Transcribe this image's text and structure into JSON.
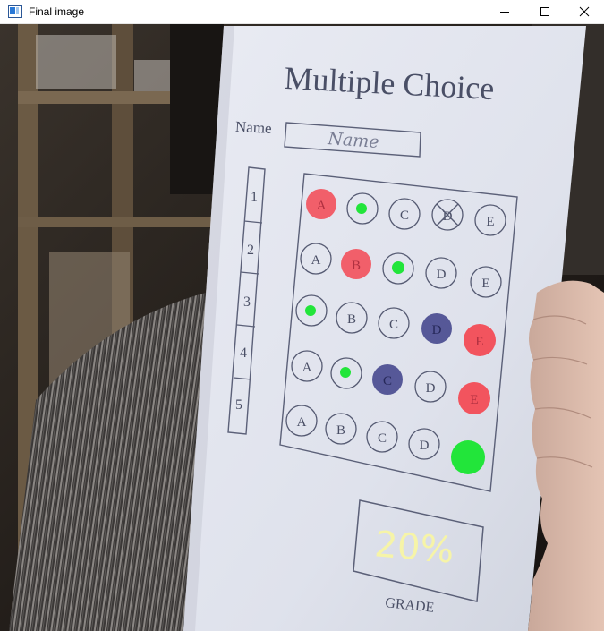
{
  "window": {
    "title": "Final image",
    "icon": "app-window-icon",
    "controls": [
      "minimize-icon",
      "maximize-icon",
      "close-icon"
    ]
  },
  "sheet": {
    "heading": "Multiple Choice",
    "name_label": "Name",
    "name_value": "Name",
    "question_numbers": [
      "1",
      "2",
      "3",
      "4",
      "5"
    ],
    "choices": [
      "A",
      "B",
      "C",
      "D",
      "E"
    ],
    "grade_value": "20%",
    "grade_label": "GRADE"
  },
  "answers": {
    "rows": [
      {
        "marked": "A",
        "correct": "B",
        "result": "wrong",
        "crossed": "D"
      },
      {
        "marked": "B",
        "correct": "C",
        "result": "wrong"
      },
      {
        "marked": "D",
        "correct": "A",
        "result": "wrong",
        "wrong_highlight": "E"
      },
      {
        "marked": "C",
        "correct": "B",
        "result": "wrong",
        "wrong_highlight": "E"
      },
      {
        "marked": "E",
        "correct": "E",
        "result": "correct"
      }
    ]
  },
  "colors": {
    "wrong": "#f2545e",
    "correct": "#22e53a",
    "pencil": "#3d3f88",
    "grade_text": "#f6f4a8",
    "paper": "#e3e6f0"
  }
}
